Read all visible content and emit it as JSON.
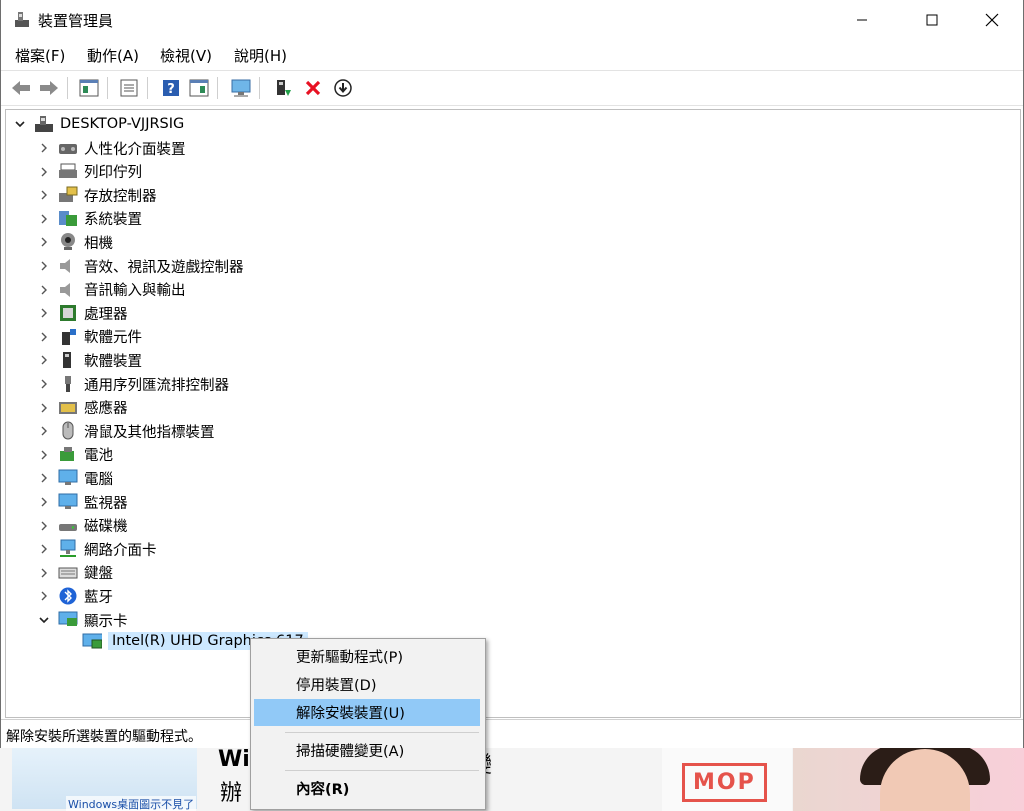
{
  "window": {
    "title": "裝置管理員"
  },
  "menu": [
    "檔案(F)",
    "動作(A)",
    "檢視(V)",
    "說明(H)"
  ],
  "toolbar": [
    {
      "name": "back-icon"
    },
    {
      "name": "forward-icon"
    },
    {
      "name": "show-hide-console-tree-icon"
    },
    {
      "name": "properties-icon"
    },
    {
      "name": "help-icon"
    },
    {
      "name": "show-hide-action-pane-icon"
    },
    {
      "name": "scan-hardware-icon"
    },
    {
      "name": "update-driver-icon"
    },
    {
      "name": "uninstall-device-icon"
    },
    {
      "name": "disable-device-icon"
    }
  ],
  "tree": {
    "root": "DESKTOP-VJJRSIG",
    "categories": [
      "人性化介面裝置",
      "列印佇列",
      "存放控制器",
      "系統裝置",
      "相機",
      "音效、視訊及遊戲控制器",
      "音訊輸入與輸出",
      "處理器",
      "軟體元件",
      "軟體裝置",
      "通用序列匯流排控制器",
      "感應器",
      "滑鼠及其他指標裝置",
      "電池",
      "電腦",
      "監視器",
      "磁碟機",
      "網路介面卡",
      "鍵盤",
      "藍牙",
      "顯示卡"
    ],
    "selected_child": "Intel(R) UHD Graphics 617"
  },
  "context_menu": {
    "items": [
      "更新驅動程式(P)",
      "停用裝置(D)",
      "解除安裝裝置(U)",
      "掃描硬體變更(A)",
      "內容(R)"
    ]
  },
  "status": "解除安裝所選裝置的驅動程式。",
  "background_page": {
    "thumb_label": "Windows桌面圖示不見了",
    "headline1": "Win",
    "headline2": "辦",
    "headline3": "變",
    "ad_text": "MOP"
  },
  "colors": {
    "selection": "#cce8ff",
    "menu_highlight": "#91c9f7",
    "uninstall_red": "#e81123"
  }
}
